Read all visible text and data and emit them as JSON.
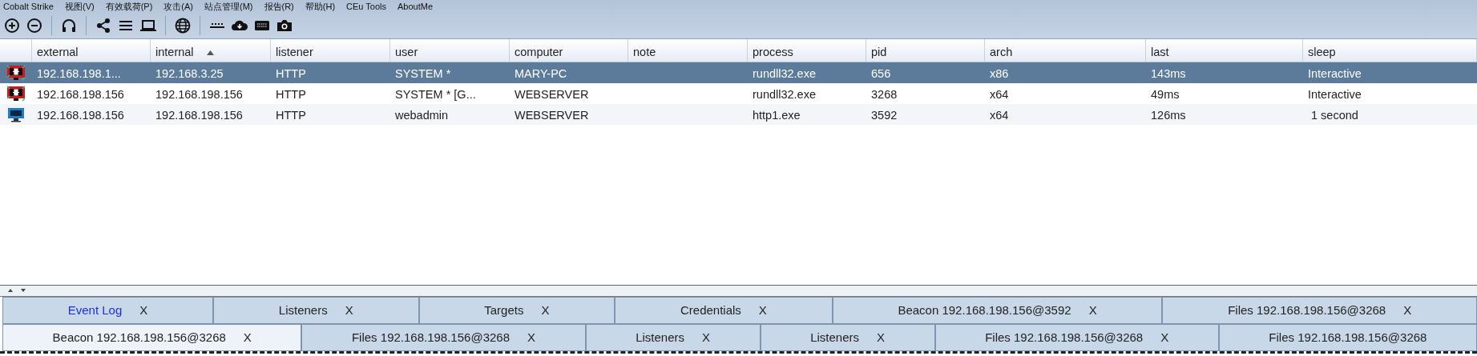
{
  "menu": [
    "Cobalt Strike",
    "视图(V)",
    "有效载荷(P)",
    "攻击(A)",
    "站点管理(M)",
    "报告(R)",
    "帮助(H)",
    "CEu Tools",
    "AboutMe"
  ],
  "toolbar": [
    {
      "kind": "plus"
    },
    {
      "kind": "minus"
    },
    {
      "kind": "sep"
    },
    {
      "kind": "headphones"
    },
    {
      "kind": "sep"
    },
    {
      "kind": "share"
    },
    {
      "kind": "list"
    },
    {
      "kind": "laptop"
    },
    {
      "kind": "sep"
    },
    {
      "kind": "globe"
    },
    {
      "kind": "sep"
    },
    {
      "kind": "dots"
    },
    {
      "kind": "cloud"
    },
    {
      "kind": "keyboard"
    },
    {
      "kind": "camera"
    }
  ],
  "table": {
    "columns": [
      {
        "label": "external",
        "sorted": false
      },
      {
        "label": "internal",
        "sorted": true
      },
      {
        "label": "listener",
        "sorted": false
      },
      {
        "label": "user",
        "sorted": false
      },
      {
        "label": "computer",
        "sorted": false
      },
      {
        "label": "note",
        "sorted": false
      },
      {
        "label": "process",
        "sorted": false
      },
      {
        "label": "pid",
        "sorted": false
      },
      {
        "label": "arch",
        "sorted": false
      },
      {
        "label": "last",
        "sorted": false
      },
      {
        "label": "sleep",
        "sorted": false
      }
    ],
    "rows": [
      {
        "kind": "admin",
        "selected": true,
        "cells": [
          "192.168.198.1...",
          "192.168.3.25",
          "HTTP",
          "SYSTEM *",
          "MARY-PC",
          "",
          "rundll32.exe",
          "656",
          "x86",
          "143ms",
          "Interactive"
        ]
      },
      {
        "kind": "admin",
        "selected": false,
        "cells": [
          "192.168.198.156",
          "192.168.198.156",
          "HTTP",
          "SYSTEM * [G...",
          "WEBSERVER",
          "",
          "rundll32.exe",
          "3268",
          "x64",
          "49ms",
          "Interactive"
        ]
      },
      {
        "kind": "user",
        "selected": false,
        "cells": [
          "192.168.198.156",
          "192.168.198.156",
          "HTTP",
          "webadmin",
          "WEBSERVER",
          "",
          "http1.exe",
          "3592",
          "x64",
          "126ms",
          " 1 second"
        ]
      }
    ]
  },
  "tab_rows": [
    [
      {
        "label": "Event Log",
        "close": "X",
        "selected": false,
        "highlighted": true
      },
      {
        "label": "Listeners",
        "close": "X",
        "selected": false,
        "highlighted": false
      },
      {
        "label": "Targets",
        "close": "X",
        "selected": false,
        "highlighted": false
      },
      {
        "label": "Credentials",
        "close": "X",
        "selected": false,
        "highlighted": false
      },
      {
        "label": "Beacon 192.168.198.156@3592",
        "close": "X",
        "selected": false,
        "highlighted": false
      },
      {
        "label": "Files 192.168.198.156@3268",
        "close": "X",
        "selected": false,
        "highlighted": false
      }
    ],
    [
      {
        "label": "Beacon 192.168.198.156@3268",
        "close": "X",
        "selected": true,
        "highlighted": false
      },
      {
        "label": "Files 192.168.198.156@3268",
        "close": "X",
        "selected": false,
        "highlighted": false
      },
      {
        "label": "Listeners",
        "close": "X",
        "selected": false,
        "highlighted": false
      },
      {
        "label": "Listeners",
        "close": "X",
        "selected": false,
        "highlighted": false
      },
      {
        "label": "Files 192.168.198.156@3268",
        "close": "X",
        "selected": false,
        "highlighted": false
      },
      {
        "label": "Files 192.168.198.156@3268",
        "selected": false,
        "highlighted": false
      }
    ]
  ]
}
